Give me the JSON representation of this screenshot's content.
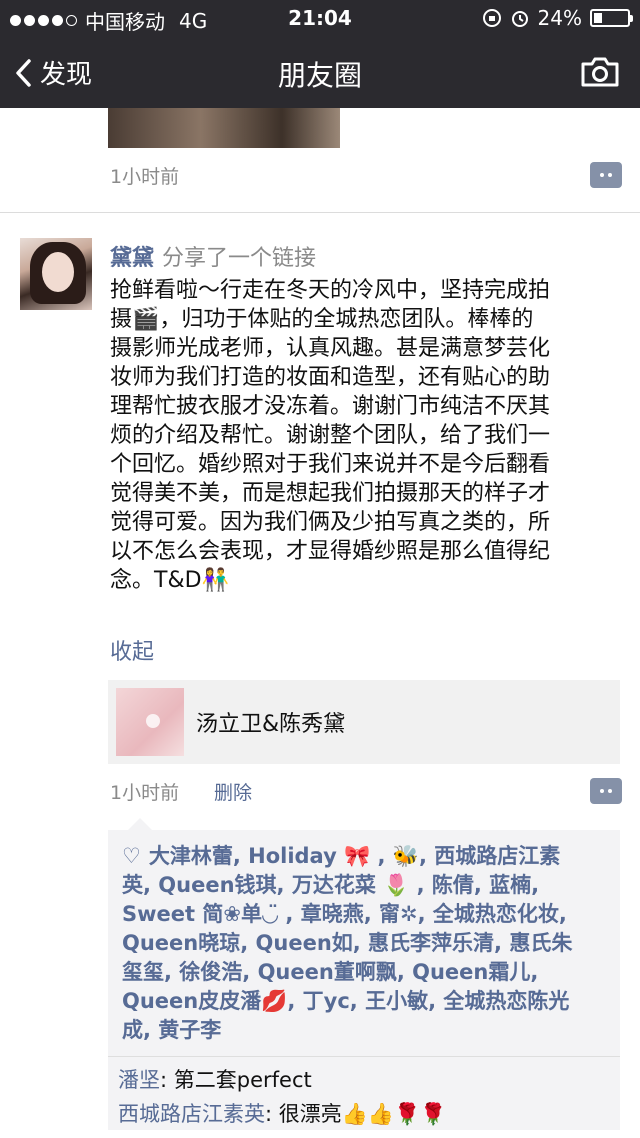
{
  "status_bar": {
    "carrier": "中国移动",
    "network": "4G",
    "time": "21:04",
    "battery": "24%",
    "battery_level": 0.24
  },
  "nav": {
    "back_label": "发现",
    "title": "朋友圈"
  },
  "previous_post": {
    "time": "1小时前"
  },
  "post": {
    "author": "黛黛",
    "action": "分享了一个链接",
    "lines": [
      "抢鲜看啦～行走在冬天的冷风中，坚持完成拍",
      "摄🎬，归功于体贴的全城热恋团队。棒棒的",
      "摄影师光成老师，认真风趣。甚是满意梦芸化",
      "妆师为我们打造的妆面和造型，还有贴心的助",
      "理帮忙披衣服才没冻着。谢谢门市纯洁不厌其",
      "烦的介绍及帮忙。谢谢整个团队，给了我们一",
      "个回忆。婚纱照对于我们来说并不是今后翻看",
      "觉得美不美，而是想起我们拍摄那天的样子才",
      "觉得可爱。因为我们俩及少拍写真之类的，所",
      "以不怎么会表现，才显得婚纱照是那么值得纪",
      "念。T&D👫"
    ],
    "collapse_label": "收起",
    "link_title": "汤立卫&陈秀黛",
    "time": "1小时前",
    "delete_label": "删除"
  },
  "likes": {
    "lines": [
      "大津林蕾, Holiday 🎀 , 🐝, 西城路店江素",
      "英, Queen钱琪, 万达花菜 🌷 , 陈倩, 蓝楠,",
      "Sweet 简❀单◡̈ , 章晓燕, 甯✲, 全城热恋化妆,",
      "Queen晓琼, Queen如, 惠氏李萍乐清, 惠氏朱",
      "玺玺, 徐俊浩, Queen董啊飘, Queen霜儿,",
      "Queen皮皮潘💋, 丁yc, 王小敏, 全城热恋陈光",
      "成, 黄子李"
    ]
  },
  "comments": [
    {
      "name": "潘坚",
      "text": "第二套perfect"
    },
    {
      "name": "西城路店江素英",
      "text": "很漂亮👍👍🌹🌹"
    }
  ]
}
